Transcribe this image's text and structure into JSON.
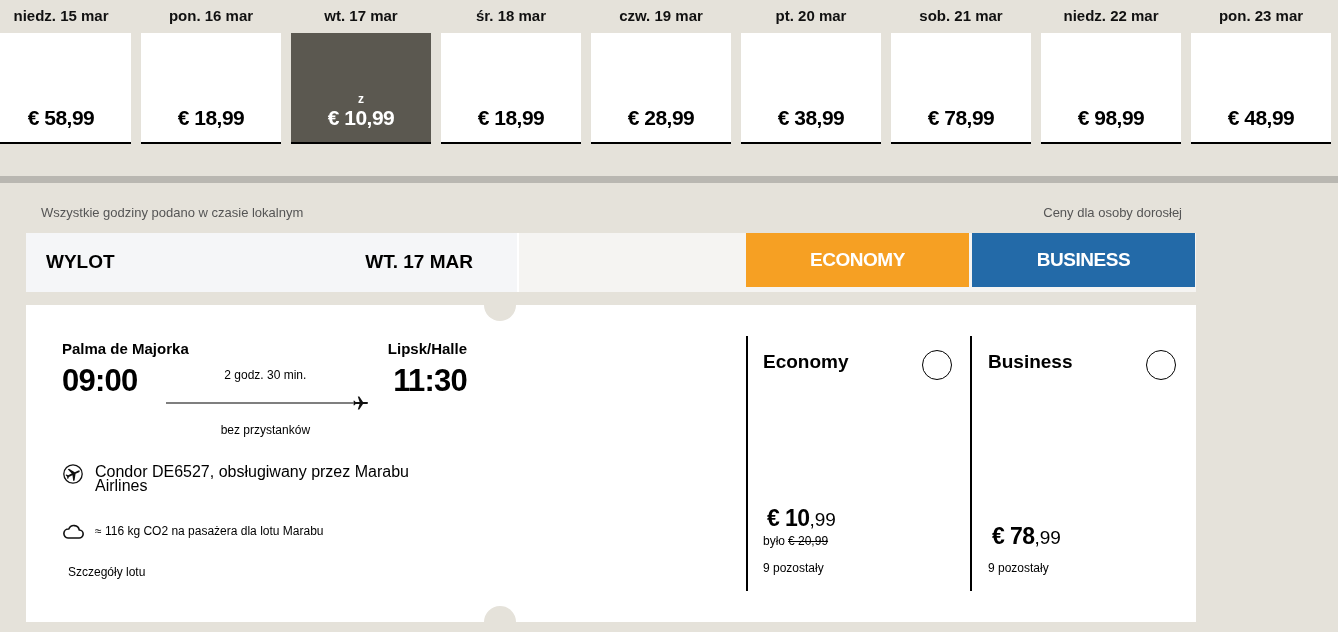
{
  "date_strip": [
    {
      "date": "niedz. 15 mar",
      "price": "€ 58,99",
      "selected": false
    },
    {
      "date": "pon. 16 mar",
      "price": "€ 18,99",
      "selected": false
    },
    {
      "date": "wt. 17 mar",
      "prefix": "z",
      "price": "€ 10,99",
      "selected": true
    },
    {
      "date": "śr. 18 mar",
      "price": "€ 18,99",
      "selected": false
    },
    {
      "date": "czw. 19 mar",
      "price": "€ 28,99",
      "selected": false
    },
    {
      "date": "pt. 20 mar",
      "price": "€ 38,99",
      "selected": false
    },
    {
      "date": "sob. 21 mar",
      "price": "€ 78,99",
      "selected": false
    },
    {
      "date": "niedz. 22 mar",
      "price": "€ 98,99",
      "selected": false
    },
    {
      "date": "pon. 23 mar",
      "price": "€ 48,99",
      "selected": false
    }
  ],
  "notes": {
    "local_time": "Wszystkie godziny podano w czasie lokalnym",
    "price_basis": "Ceny dla osoby dorosłej"
  },
  "header": {
    "title": "WYLOT",
    "date": "WT. 17 MAR",
    "class_tabs": [
      {
        "label": "ECONOMY",
        "color": "#f6a023"
      },
      {
        "label": "BUSINESS",
        "color": "#236aa8"
      }
    ]
  },
  "flight": {
    "departure": {
      "city": "Palma de Majorka",
      "time": "09:00"
    },
    "duration": "2 godz. 30 min.",
    "stops": "bez przystanków",
    "arrival": {
      "city": "Lipsk/Halle",
      "time": "11:30"
    },
    "operator": "Condor DE6527, obsługiwany przez Marabu Airlines",
    "emissions": "≈ 116 kg CO2 na pasażera dla lotu Marabu",
    "details_link": "Szczegóły lotu"
  },
  "fares": [
    {
      "name": "Economy",
      "selected": false,
      "price_main": "€ 10",
      "price_cents": ",99",
      "was_label": "było",
      "was_price": "€ 20,99",
      "remaining": "9 pozostały"
    },
    {
      "name": "Business",
      "selected": false,
      "price_main": "€ 78",
      "price_cents": ",99",
      "remaining": "9 pozostały"
    }
  ]
}
